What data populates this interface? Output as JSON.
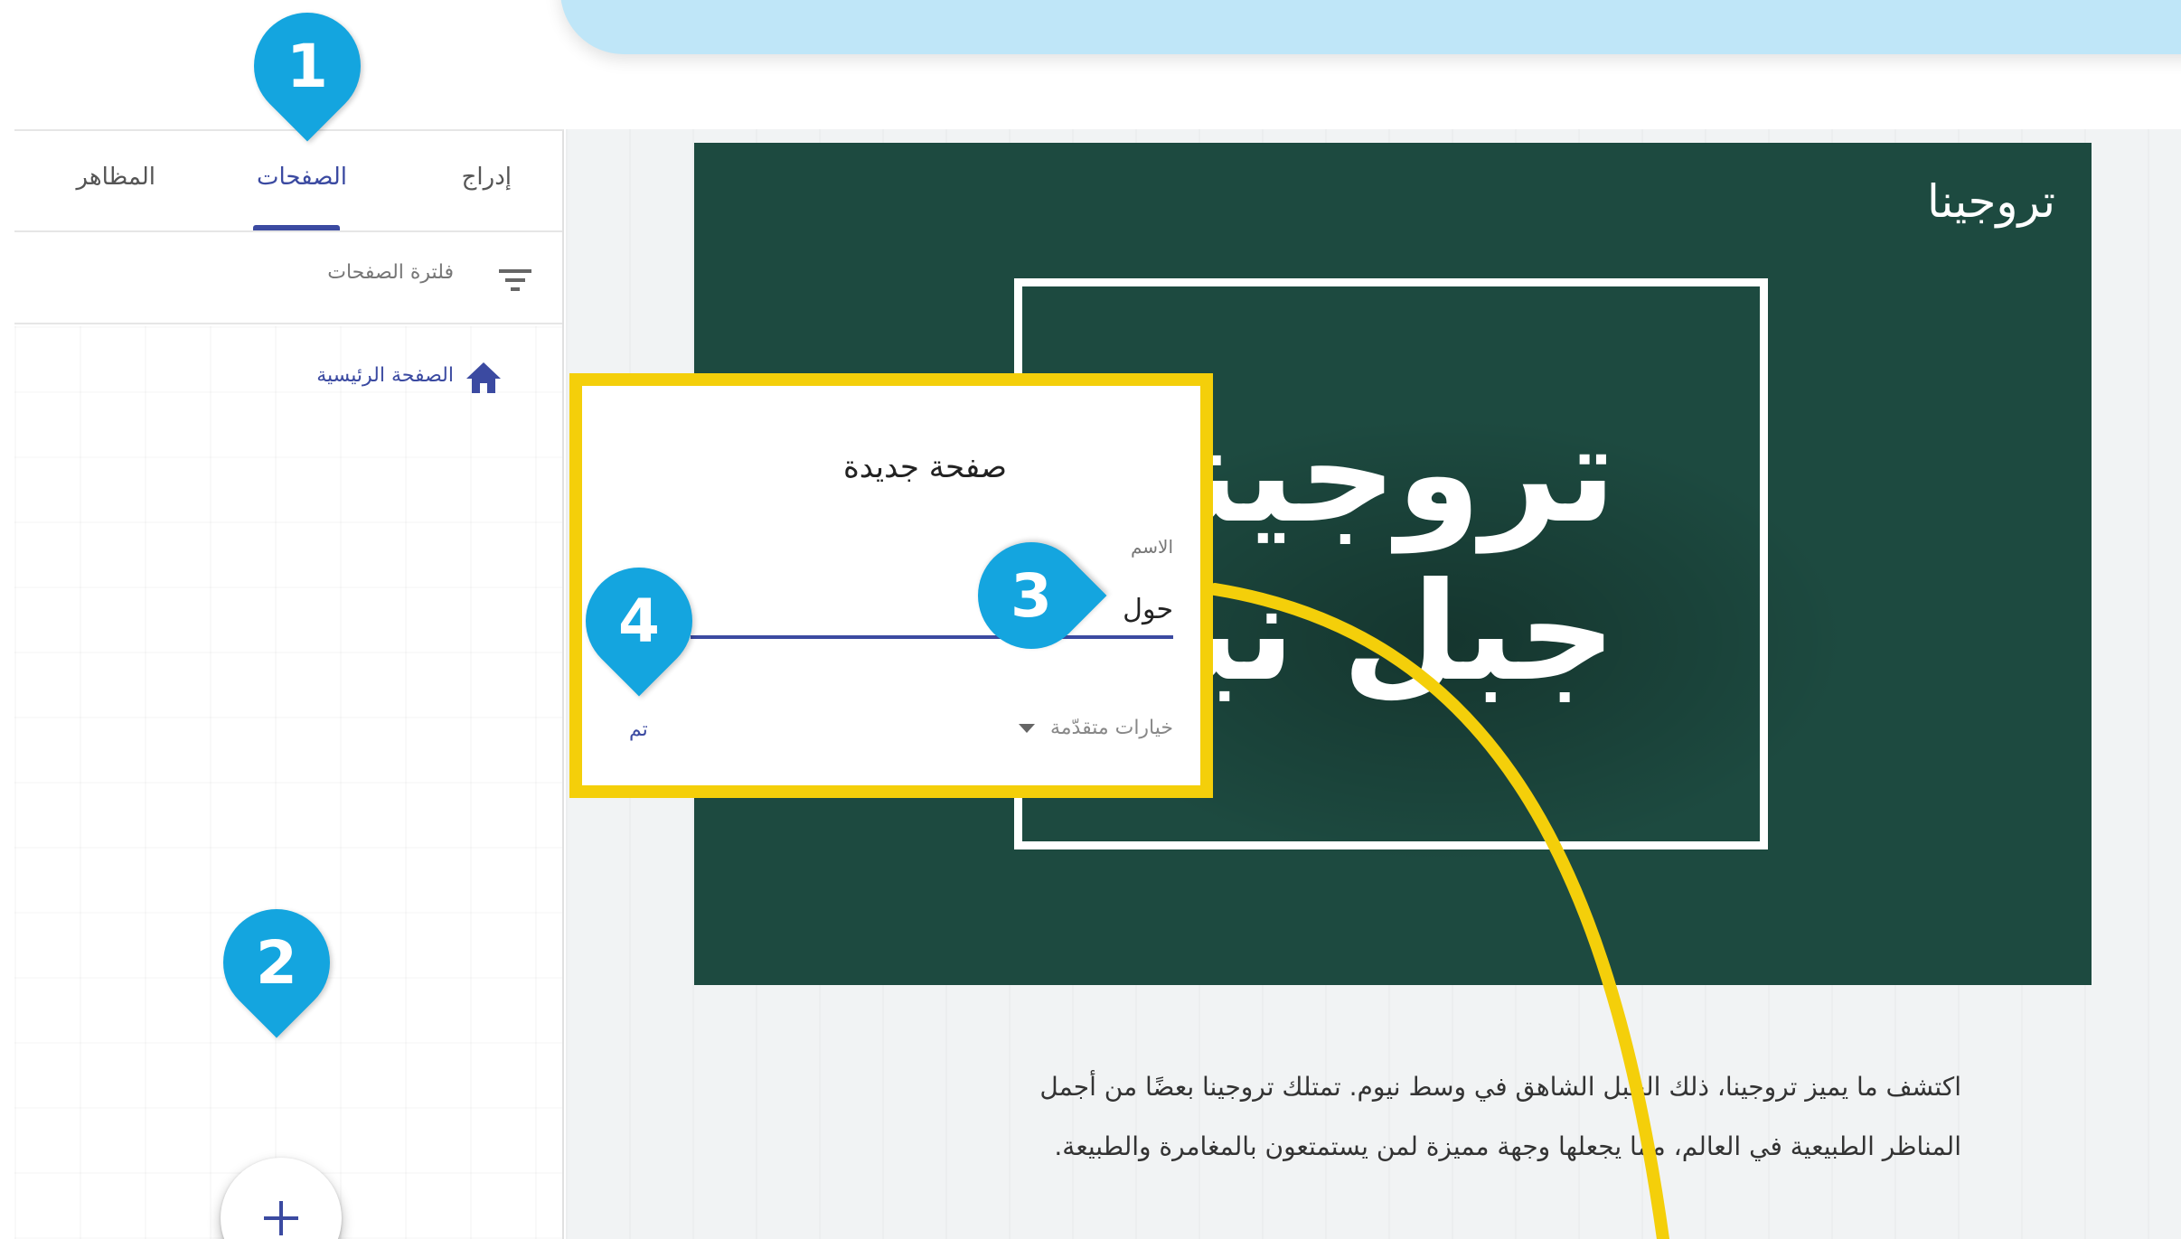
{
  "sidebar": {
    "tabs": [
      {
        "label": "إدراج"
      },
      {
        "label": "الصفحات"
      },
      {
        "label": "المظاهر"
      }
    ],
    "active_tab": "الصفحات",
    "filter_label": "فلترة الصفحات",
    "home_page_label": "الصفحة الرئيسية",
    "add_page_label": "+"
  },
  "site": {
    "name": "تروجينا",
    "hero_title_line1": "تروجينا",
    "hero_title_line2": "جبل نيوم",
    "body_line1": "اكتشف ما يميز تروجينا، ذلك الجبل الشاهق في وسط نيوم. تمتلك تروجينا بعضًا من أجمل",
    "body_line2": "المناظر الطبيعية في العالم، مما يجعلها وجهة مميزة لمن يستمتعون بالمغامرة والطبيعة."
  },
  "dialog": {
    "title": "صفحة جديدة",
    "name_label": "الاسم",
    "name_value": "حول",
    "advanced_options": "خيارات متقدّمة",
    "done_label": "تم"
  },
  "callouts": [
    "1",
    "2",
    "3",
    "4"
  ],
  "colors": {
    "accent": "#3b4aa1",
    "callout": "#14a5df",
    "highlight": "#f4cf0a",
    "hero_bg": "#1d4a40",
    "banner": "#bfe6f8"
  }
}
